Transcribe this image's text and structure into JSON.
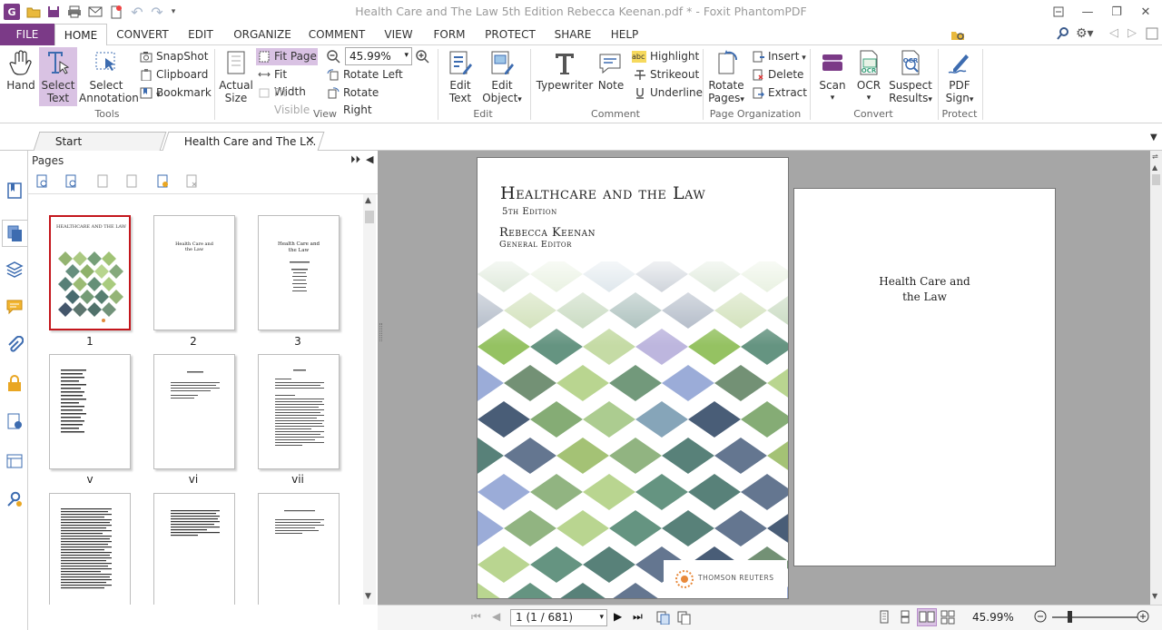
{
  "window": {
    "title": "Health Care and The Law 5th Edition Rebecca Keenan.pdf * - Foxit PhantomPDF"
  },
  "colors": {
    "accent": "#7b3a87",
    "selected": "#d9c2e3"
  },
  "menu": {
    "file": "FILE",
    "home": "HOME",
    "convert": "CONVERT",
    "edit": "EDIT",
    "organize": "ORGANIZE",
    "comment": "COMMENT",
    "view": "VIEW",
    "form": "FORM",
    "protect": "PROTECT",
    "share": "SHARE",
    "help": "HELP"
  },
  "search": {
    "placeholder": "Find"
  },
  "ribbon": {
    "tools": {
      "group": "Tools",
      "hand": "Hand",
      "select_text": [
        "Select",
        "Text"
      ],
      "select_annotation": [
        "Select",
        "Annotation"
      ],
      "snapshot": "SnapShot",
      "clipboard": "Clipboard",
      "bookmark": "Bookmark"
    },
    "view": {
      "group": "View",
      "actual_size": [
        "Actual",
        "Size"
      ],
      "fit_page": "Fit Page",
      "fit_width": "Fit Width",
      "fit_visible": "Fit Visible",
      "zoom": "45.99%",
      "rotate_left": "Rotate Left",
      "rotate_right": "Rotate Right"
    },
    "edit": {
      "group": "Edit",
      "edit_text": [
        "Edit",
        "Text"
      ],
      "edit_object": [
        "Edit",
        "Object"
      ]
    },
    "comment": {
      "group": "Comment",
      "typewriter": "Typewriter",
      "note": "Note",
      "highlight": "Highlight",
      "strikeout": "Strikeout",
      "underline": "Underline",
      "abc": "abc"
    },
    "page_org": {
      "group": "Page Organization",
      "rotate_pages": [
        "Rotate",
        "Pages"
      ],
      "insert": "Insert",
      "delete": "Delete",
      "extract": "Extract"
    },
    "convert": {
      "group": "Convert",
      "scan": "Scan",
      "ocr": "OCR",
      "suspect": [
        "Suspect",
        "Results"
      ],
      "ocr_badge": "OCR"
    },
    "protect": {
      "group": "Protect",
      "pdf_sign": [
        "PDF",
        "Sign"
      ]
    }
  },
  "tabs": [
    {
      "label": "Start"
    },
    {
      "label": "Health Care and The L..."
    }
  ],
  "pages_panel": {
    "title": "Pages",
    "thumbnails": [
      {
        "label": "1"
      },
      {
        "label": "2"
      },
      {
        "label": "3"
      },
      {
        "label": "v"
      },
      {
        "label": "vi"
      },
      {
        "label": "vii"
      },
      {
        "label": ""
      },
      {
        "label": ""
      },
      {
        "label": ""
      }
    ],
    "thumb2_text": [
      "Health Care and",
      "the Law"
    ],
    "thumb3_text": [
      "Health Care and",
      "the Law"
    ]
  },
  "document": {
    "cover": {
      "title": "Healthcare and the Law",
      "edition": "5th Edition",
      "author": "Rebecca Keenan",
      "role": "General Editor",
      "publisher": "THOMSON REUTERS"
    },
    "page2": {
      "title_line1": "Health Care and",
      "title_line2": "the Law"
    }
  },
  "status": {
    "page_nav": "1 (1 / 681)",
    "zoom": "45.99%"
  }
}
